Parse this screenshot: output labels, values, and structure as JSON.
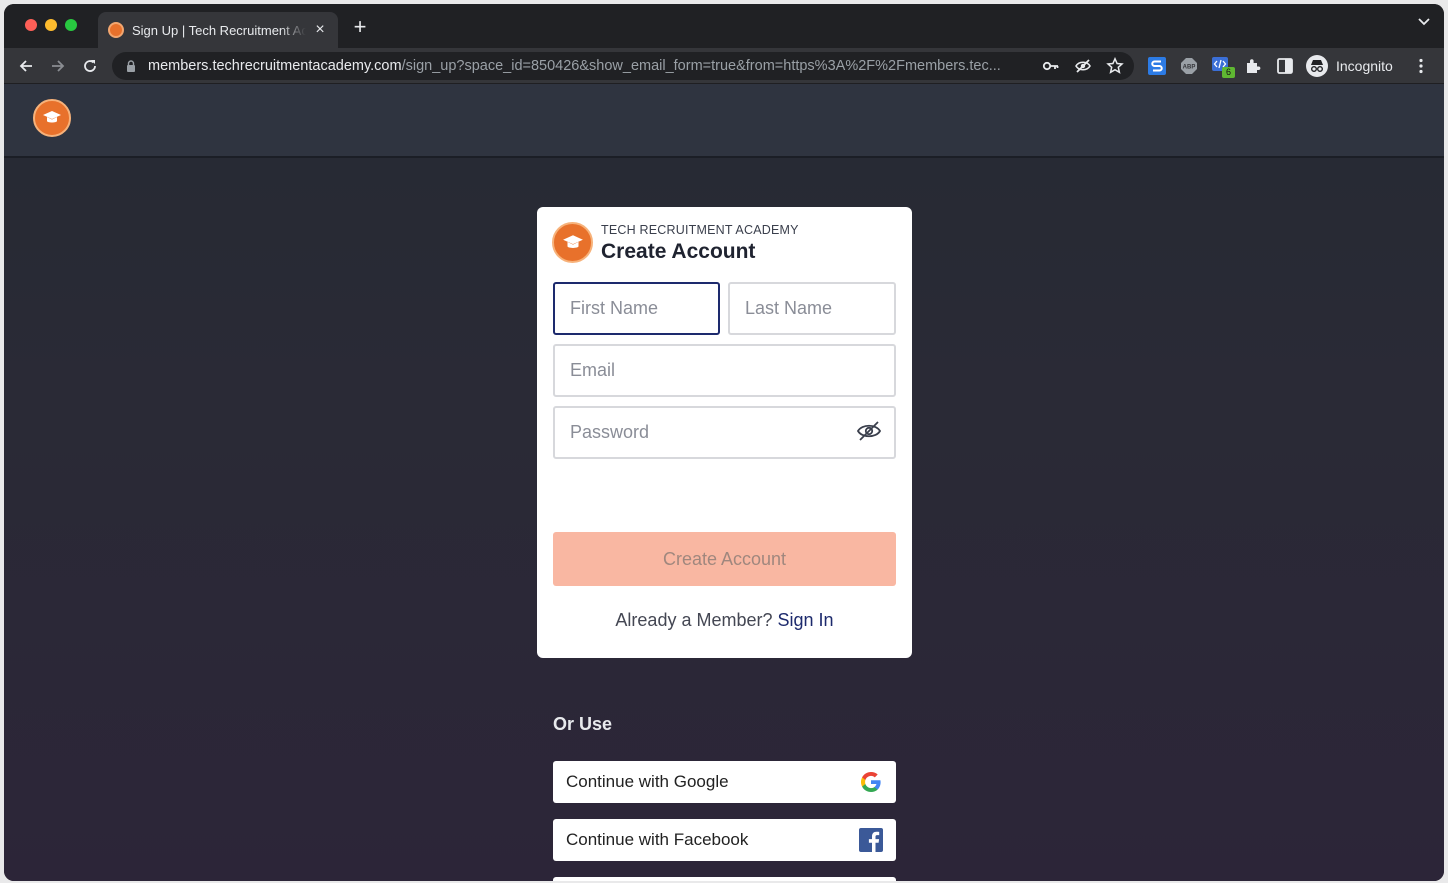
{
  "browser": {
    "tab_title": "Sign Up | Tech Recruitment Academy",
    "tab_close": "×",
    "new_tab": "+",
    "url_host": "members.techrecruitmentacademy.com",
    "url_path": "/sign_up?space_id=850426&show_email_form=true&from=https%3A%2F%2Fmembers.tec...",
    "profile_label": "Incognito",
    "extension_badge": "6"
  },
  "card": {
    "brand_sub": "TECH RECRUITMENT ACADEMY",
    "title": "Create Account",
    "first_name_placeholder": "First Name",
    "last_name_placeholder": "Last Name",
    "email_placeholder": "Email",
    "password_placeholder": "Password",
    "submit_label": "Create Account",
    "member_prompt": "Already a Member?",
    "sign_in_label": "Sign In"
  },
  "social": {
    "heading": "Or Use",
    "google_label": "Continue with Google",
    "facebook_label": "Continue with Facebook"
  },
  "colors": {
    "accent": "#1d2a6d",
    "brand_orange": "#e8712b",
    "button_disabled": "#f9b7a2"
  }
}
